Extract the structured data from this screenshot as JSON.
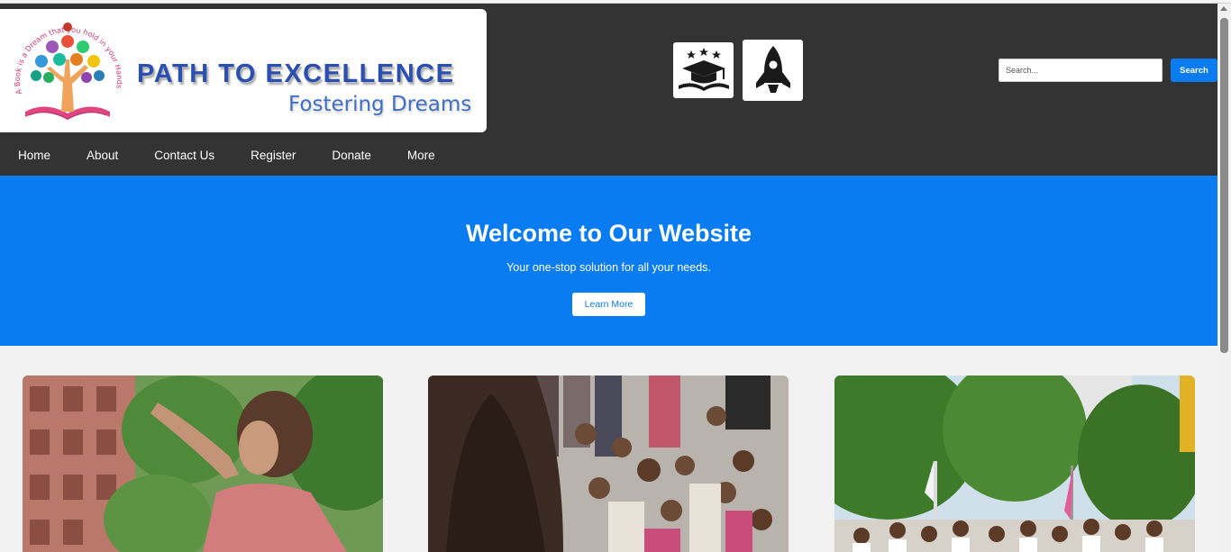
{
  "header": {
    "logo": {
      "title": "PATH TO EXCELLENCE",
      "subtitle": "Fostering Dreams",
      "tagline": "A Book is a Dream that you hold in your Hands"
    },
    "badges": [
      {
        "icon": "graduation-cap-stars-icon"
      },
      {
        "icon": "rocket-icon"
      }
    ],
    "search": {
      "placeholder": "Search...",
      "button_label": "Search"
    }
  },
  "nav": {
    "items": [
      {
        "label": "Home"
      },
      {
        "label": "About"
      },
      {
        "label": "Contact Us"
      },
      {
        "label": "Register"
      },
      {
        "label": "Donate"
      },
      {
        "label": "More"
      }
    ]
  },
  "hero": {
    "title": "Welcome to Our Website",
    "subtitle": "Your one-stop solution for all your needs.",
    "button_label": "Learn More"
  },
  "cards": [
    {
      "image": "girl-pointing-photo"
    },
    {
      "image": "children-group-photo"
    },
    {
      "image": "students-saluting-photo"
    }
  ],
  "colors": {
    "header_bg": "#333333",
    "accent": "#0a7cf2",
    "page_bg": "#f2f2f2"
  }
}
